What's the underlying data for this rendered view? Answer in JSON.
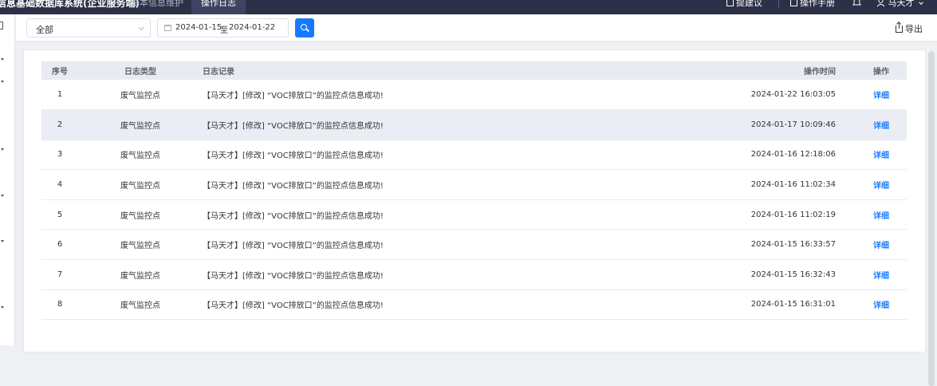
{
  "header": {
    "app_title": "信息基础数据库系统(企业服务端)",
    "tabs": [
      {
        "label": "基本信息维护",
        "active": false
      },
      {
        "label": "操作日志",
        "active": true
      }
    ],
    "suggest_label": "提建议",
    "manual_label": "操作手册",
    "user_name": "马天才"
  },
  "toolbar": {
    "log_type_value": "全部",
    "date_start": "2024-01-15",
    "date_sep": "至",
    "date_end": "2024-01-22",
    "export_label": "导出"
  },
  "table": {
    "columns": [
      "序号",
      "日志类型",
      "日志记录",
      "操作时间",
      "操作"
    ],
    "rows": [
      {
        "index": "1",
        "type": "废气监控点",
        "record": "【马天才】[修改] “VOC排放口”的监控点信息成功!",
        "time": "2024-01-22 16:03:05",
        "action": "详细"
      },
      {
        "index": "2",
        "type": "废气监控点",
        "record": "【马天才】[修改] “VOC排放口”的监控点信息成功!",
        "time": "2024-01-17 10:09:46",
        "action": "详细"
      },
      {
        "index": "3",
        "type": "废气监控点",
        "record": "【马天才】[修改] “VOC排放口”的监控点信息成功!",
        "time": "2024-01-16 12:18:06",
        "action": "详细"
      },
      {
        "index": "4",
        "type": "废气监控点",
        "record": "【马天才】[修改] “VOC排放口”的监控点信息成功!",
        "time": "2024-01-16 11:02:34",
        "action": "详细"
      },
      {
        "index": "5",
        "type": "废气监控点",
        "record": "【马天才】[修改] “VOC排放口”的监控点信息成功!",
        "time": "2024-01-16 11:02:19",
        "action": "详细"
      },
      {
        "index": "6",
        "type": "废气监控点",
        "record": "【马天才】[修改] “VOC排放口”的监控点信息成功!",
        "time": "2024-01-15 16:33:57",
        "action": "详细"
      },
      {
        "index": "7",
        "type": "废气监控点",
        "record": "【马天才】[修改] “VOC排放口”的监控点信息成功!",
        "time": "2024-01-15 16:32:43",
        "action": "详细"
      },
      {
        "index": "8",
        "type": "废气监控点",
        "record": "【马天才】[修改] “VOC排放口”的监控点信息成功!",
        "time": "2024-01-15 16:31:01",
        "action": "详细"
      }
    ]
  },
  "colors": {
    "header_bg": "#2d3147",
    "accent": "#1779ff",
    "highlight_row": "#eaedf4"
  },
  "icons": [
    "calendar-icon",
    "search-icon",
    "export-icon",
    "bell-icon",
    "user-icon",
    "edit-icon",
    "book-icon",
    "chevron-down-icon"
  ]
}
